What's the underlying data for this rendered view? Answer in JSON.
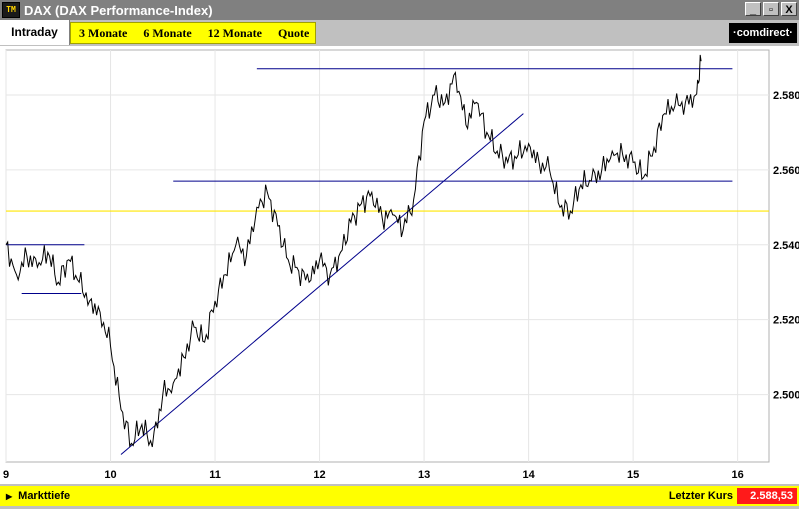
{
  "window": {
    "title": "DAX (DAX Performance-Index)",
    "icon": "TM",
    "buttons": [
      "_",
      "▫",
      "X"
    ]
  },
  "tabs": {
    "active": "Intraday",
    "items": [
      "3 Monate",
      "6 Monate",
      "12 Monate",
      "Quote"
    ]
  },
  "logo": "·comdirect·",
  "footer": {
    "left_label": "Markttiefe",
    "right_label": "Letzter Kurs",
    "value": "2.588,53"
  },
  "chart_data": {
    "type": "line",
    "x_ticks": [
      "9",
      "10",
      "11",
      "12",
      "13",
      "14",
      "15",
      "16"
    ],
    "y_ticks": [
      "2.500",
      "2.520",
      "2.540",
      "2.560",
      "2.580"
    ],
    "ylim": [
      2482,
      2592
    ],
    "series": [
      {
        "x": [
          9.0,
          9.1,
          9.2,
          9.3,
          9.4,
          9.5,
          9.6,
          9.7,
          9.8,
          9.9,
          10.0,
          10.1,
          10.2,
          10.3,
          10.4,
          10.5,
          10.6,
          10.7,
          10.8,
          10.9,
          11.0,
          11.1,
          11.2,
          11.3,
          11.4,
          11.5,
          11.6,
          11.7,
          11.8,
          11.9,
          12.0,
          12.1,
          12.2,
          12.3,
          12.4,
          12.5,
          12.6,
          12.7,
          12.8,
          12.9,
          13.0,
          13.1,
          13.2,
          13.3,
          13.4,
          13.5,
          13.6,
          13.7,
          13.8,
          13.9,
          14.0,
          14.1,
          14.2,
          14.3,
          14.4,
          14.5,
          14.6,
          14.7,
          14.8,
          14.9,
          15.0,
          15.1,
          15.2,
          15.3,
          15.4,
          15.5,
          15.6,
          15.65
        ],
        "y": [
          2540,
          2532,
          2537,
          2534,
          2538,
          2530,
          2536,
          2530,
          2525,
          2522,
          2513,
          2496,
          2487,
          2492,
          2486,
          2500,
          2503,
          2510,
          2518,
          2514,
          2525,
          2532,
          2540,
          2537,
          2550,
          2554,
          2545,
          2536,
          2533,
          2530,
          2536,
          2532,
          2538,
          2546,
          2551,
          2554,
          2547,
          2548,
          2544,
          2552,
          2573,
          2580,
          2578,
          2586,
          2572,
          2578,
          2570,
          2565,
          2562,
          2564,
          2567,
          2562,
          2560,
          2550,
          2549,
          2556,
          2557,
          2560,
          2565,
          2564,
          2562,
          2558,
          2566,
          2575,
          2577,
          2578,
          2580,
          2589
        ]
      }
    ],
    "lines": {
      "hlines_navy": [
        {
          "y": 2587,
          "from": 11.4,
          "to": 15.95
        },
        {
          "y": 2557,
          "from": 10.6,
          "to": 15.95
        },
        {
          "y": 2540,
          "from": 9.0,
          "to": 9.75
        },
        {
          "y": 2527,
          "from": 9.15,
          "to": 9.72
        }
      ],
      "hline_yellow": {
        "y": 2549
      },
      "trendline": {
        "x1": 10.1,
        "y1": 2484,
        "x2": 13.95,
        "y2": 2575
      }
    },
    "colors": {
      "series": "#000000",
      "lines": "#00008b",
      "yellow": "#ffe600",
      "grid": "#e6e6e6"
    }
  }
}
